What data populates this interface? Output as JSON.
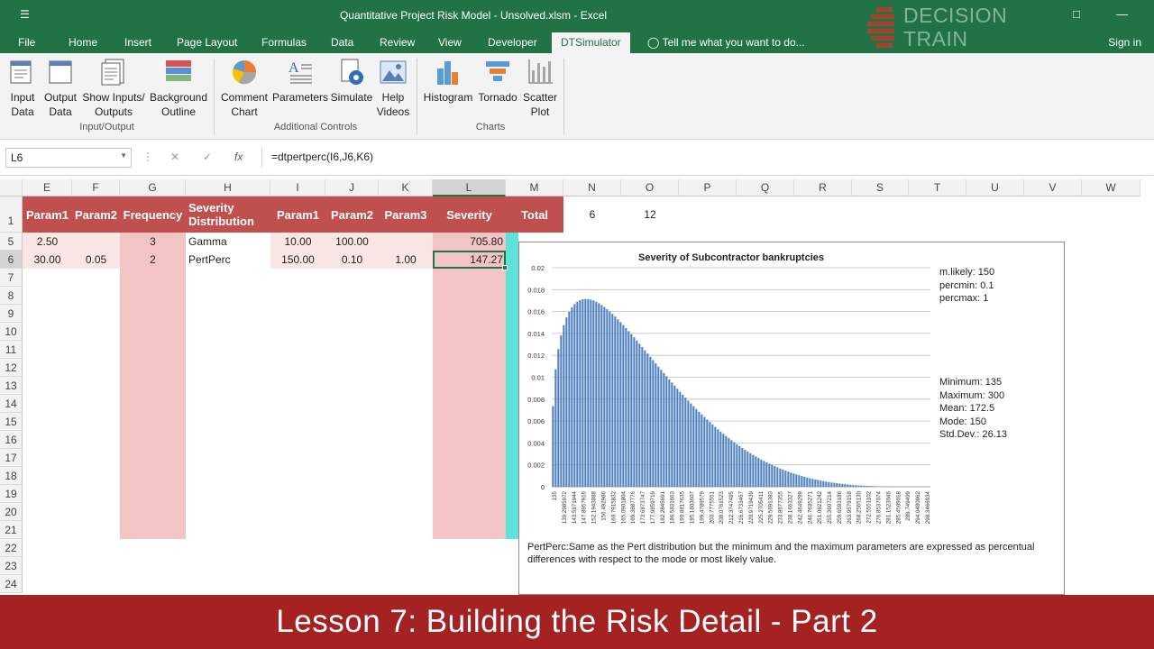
{
  "window": {
    "title": "Quantitative Project Risk Model - Unsolved.xlsm - Excel",
    "logo_text": [
      "DECISION",
      "TRAIN"
    ]
  },
  "tabs": [
    "File",
    "Home",
    "Insert",
    "Page Layout",
    "Formulas",
    "Data",
    "Review",
    "View",
    "Developer",
    "DTSimulator"
  ],
  "active_tab": "DTSimulator",
  "tell_me": "Tell me what you want to do...",
  "sign_in": "Sign in",
  "ribbon": {
    "groups": [
      "Input/Output",
      "Additional Controls",
      "Charts"
    ],
    "buttons": [
      {
        "label": "Input\nData",
        "icon": "input-data-icon"
      },
      {
        "label": "Output\nData",
        "icon": "output-data-icon"
      },
      {
        "label": "Show Inputs/\nOutputs",
        "icon": "show-io-icon"
      },
      {
        "label": "Background\nOutline",
        "icon": "background-outline-icon"
      },
      {
        "label": "Comment\nChart",
        "icon": "pie-chart-icon"
      },
      {
        "label": "Parameters",
        "icon": "parameters-icon"
      },
      {
        "label": "Simulate",
        "icon": "simulate-icon"
      },
      {
        "label": "Help\nVideos",
        "icon": "help-videos-icon"
      },
      {
        "label": "Histogram",
        "icon": "histogram-icon"
      },
      {
        "label": "Tornado",
        "icon": "tornado-icon"
      },
      {
        "label": "Scatter\nPlot",
        "icon": "scatter-plot-icon"
      }
    ]
  },
  "formula_bar": {
    "name_box": "L6",
    "formula": "=dtpertperc(I6,J6,K6)",
    "fx": "fx"
  },
  "columns": [
    "E",
    "F",
    "G",
    "H",
    "I",
    "J",
    "K",
    "L",
    "M",
    "N",
    "O",
    "P",
    "Q",
    "R",
    "S",
    "T",
    "U",
    "V",
    "W"
  ],
  "rows": [
    "1",
    "5",
    "6",
    "7",
    "8",
    "9",
    "10",
    "11",
    "12",
    "13",
    "14",
    "15",
    "16",
    "17",
    "18",
    "19",
    "20",
    "21",
    "22",
    "23",
    "24"
  ],
  "header_row": {
    "E": "Param1",
    "F": "Param2",
    "G": "Frequency",
    "H": "Severity Distribution",
    "I": "Param1",
    "J": "Param2",
    "K": "Param3",
    "L": "Severity",
    "M": "Total",
    "N": "6",
    "O": "12"
  },
  "data_rows": [
    {
      "E": "2.50",
      "F": "",
      "G": "3",
      "H": "Gamma",
      "I": "10.00",
      "J": "100.00",
      "K": "",
      "L": "705.80"
    },
    {
      "E": "30.00",
      "F": "0.05",
      "G": "2",
      "H": "PertPerc",
      "I": "150.00",
      "J": "0.10",
      "K": "1.00",
      "L": "147.27"
    }
  ],
  "chart_data": {
    "type": "bar",
    "title": "Severity of Subcontractor bankruptcies",
    "ylim": [
      0,
      0.02
    ],
    "yticks": [
      "0",
      "0.002",
      "0.004",
      "0.006",
      "0.008",
      "0.01",
      "0.012",
      "0.014",
      "0.016",
      "0.018",
      "0.02"
    ],
    "xlabels": [
      "135",
      "139.2985972",
      "143.5971944",
      "147.8957916",
      "152.1943888",
      "156.492986",
      "160.7915832",
      "165.0901804",
      "169.3887776",
      "173.6873747",
      "177.9859719",
      "182.2845691",
      "186.5831663",
      "190.8817635",
      "195.1803607",
      "199.4789579",
      "203.7775551",
      "208.0761523",
      "212.3747495",
      "216.6733467",
      "220.9719439",
      "225.2705411",
      "229.5691383",
      "233.8677355",
      "238.1663327",
      "242.4649299",
      "246.7635271",
      "251.0621242",
      "255.3607214",
      "259.6593186",
      "263.9579158",
      "268.2565130",
      "272.5551102",
      "276.8537074",
      "281.1523046",
      "285.4509018",
      "289.749499",
      "294.0480962",
      "298.3466934"
    ],
    "series": [
      {
        "distribution": "pert",
        "min": 135,
        "mode": 150,
        "max": 300,
        "bins": 140
      }
    ],
    "annotations": {
      "params": [
        "m.likely: 150",
        "percmin: 0.1",
        "percmax: 1"
      ],
      "stats": [
        "Minimum: 135",
        "Maximum: 300",
        "Mean: 172.5",
        "Mode: 150",
        "Std.Dev.: 26.13"
      ]
    },
    "description": "PertPerc:Same as the Pert distribution but the minimum and the maximum parameters are expressed as percentual differences with respect to the mode or most likely value."
  },
  "banner": "Lesson 7: Building the Risk Detail - Part 2",
  "colors": {
    "excel_green": "#217346",
    "header_red": "#c0504d",
    "pink": "#f2c4c4",
    "banner": "#a52222",
    "bar_blue": "#4f81bd"
  }
}
